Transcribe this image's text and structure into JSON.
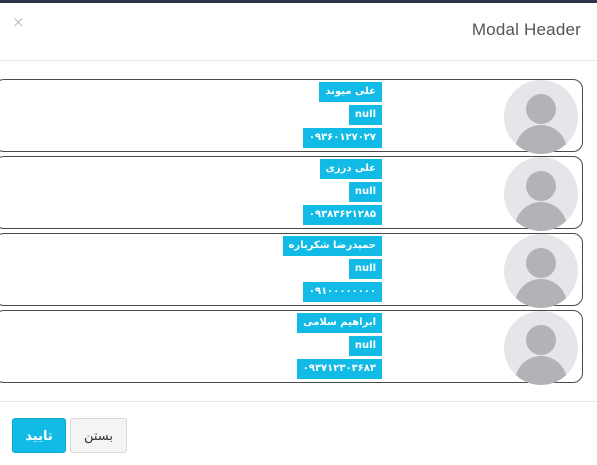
{
  "header": {
    "title": "Modal Header",
    "close_symbol": "×"
  },
  "contacts": [
    {
      "name": "علی میوند",
      "info": "null",
      "phone": "۰۹۳۶۰۱۲۷۰۲۷",
      "avatar_icon": "user-avatar-icon"
    },
    {
      "name": "علی درزی",
      "info": "null",
      "phone": "۰۹۳۸۳۶۲۱۲۸۵",
      "avatar_icon": "user-avatar-icon"
    },
    {
      "name": "حمیدرضا شکرباره",
      "info": "null",
      "phone": "۰۹۱۰۰۰۰۰۰۰۰",
      "avatar_icon": "user-avatar-icon"
    },
    {
      "name": "ابراهیم سلامی",
      "info": "null",
      "phone": "۰۹۳۷۱۲۳۰۳۶۸۳",
      "avatar_icon": "user-avatar-icon"
    }
  ],
  "footer": {
    "confirm_label": "تایید",
    "close_label": "بستن"
  },
  "colors": {
    "accent": "#11bbe6",
    "card_border": "#4a4a4a",
    "avatar_bg": "#e4e6ea"
  }
}
